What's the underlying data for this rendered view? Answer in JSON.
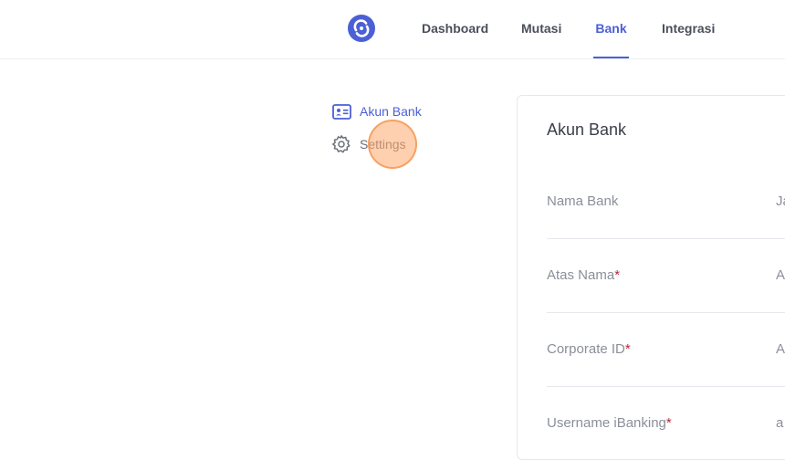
{
  "nav": {
    "items": [
      {
        "label": "Dashboard",
        "active": false
      },
      {
        "label": "Mutasi",
        "active": false
      },
      {
        "label": "Bank",
        "active": true
      },
      {
        "label": "Integrasi",
        "active": false
      }
    ]
  },
  "sidebar": {
    "items": [
      {
        "label": "Akun Bank",
        "icon": "id-card-icon",
        "active": true
      },
      {
        "label": "Settings",
        "icon": "gear-icon",
        "active": false
      }
    ]
  },
  "card": {
    "title": "Akun Bank",
    "fields": [
      {
        "label": "Nama Bank",
        "required": "",
        "value": "Ja"
      },
      {
        "label": "Atas Nama",
        "required": "*",
        "value": "A"
      },
      {
        "label": "Corporate ID",
        "required": "*",
        "value": "A"
      },
      {
        "label": "Username iBanking",
        "required": "*",
        "value": "a"
      }
    ]
  },
  "colors": {
    "accent": "#4b5fd6",
    "required": "#b3283a",
    "click_marker": "#ffaa6e"
  }
}
